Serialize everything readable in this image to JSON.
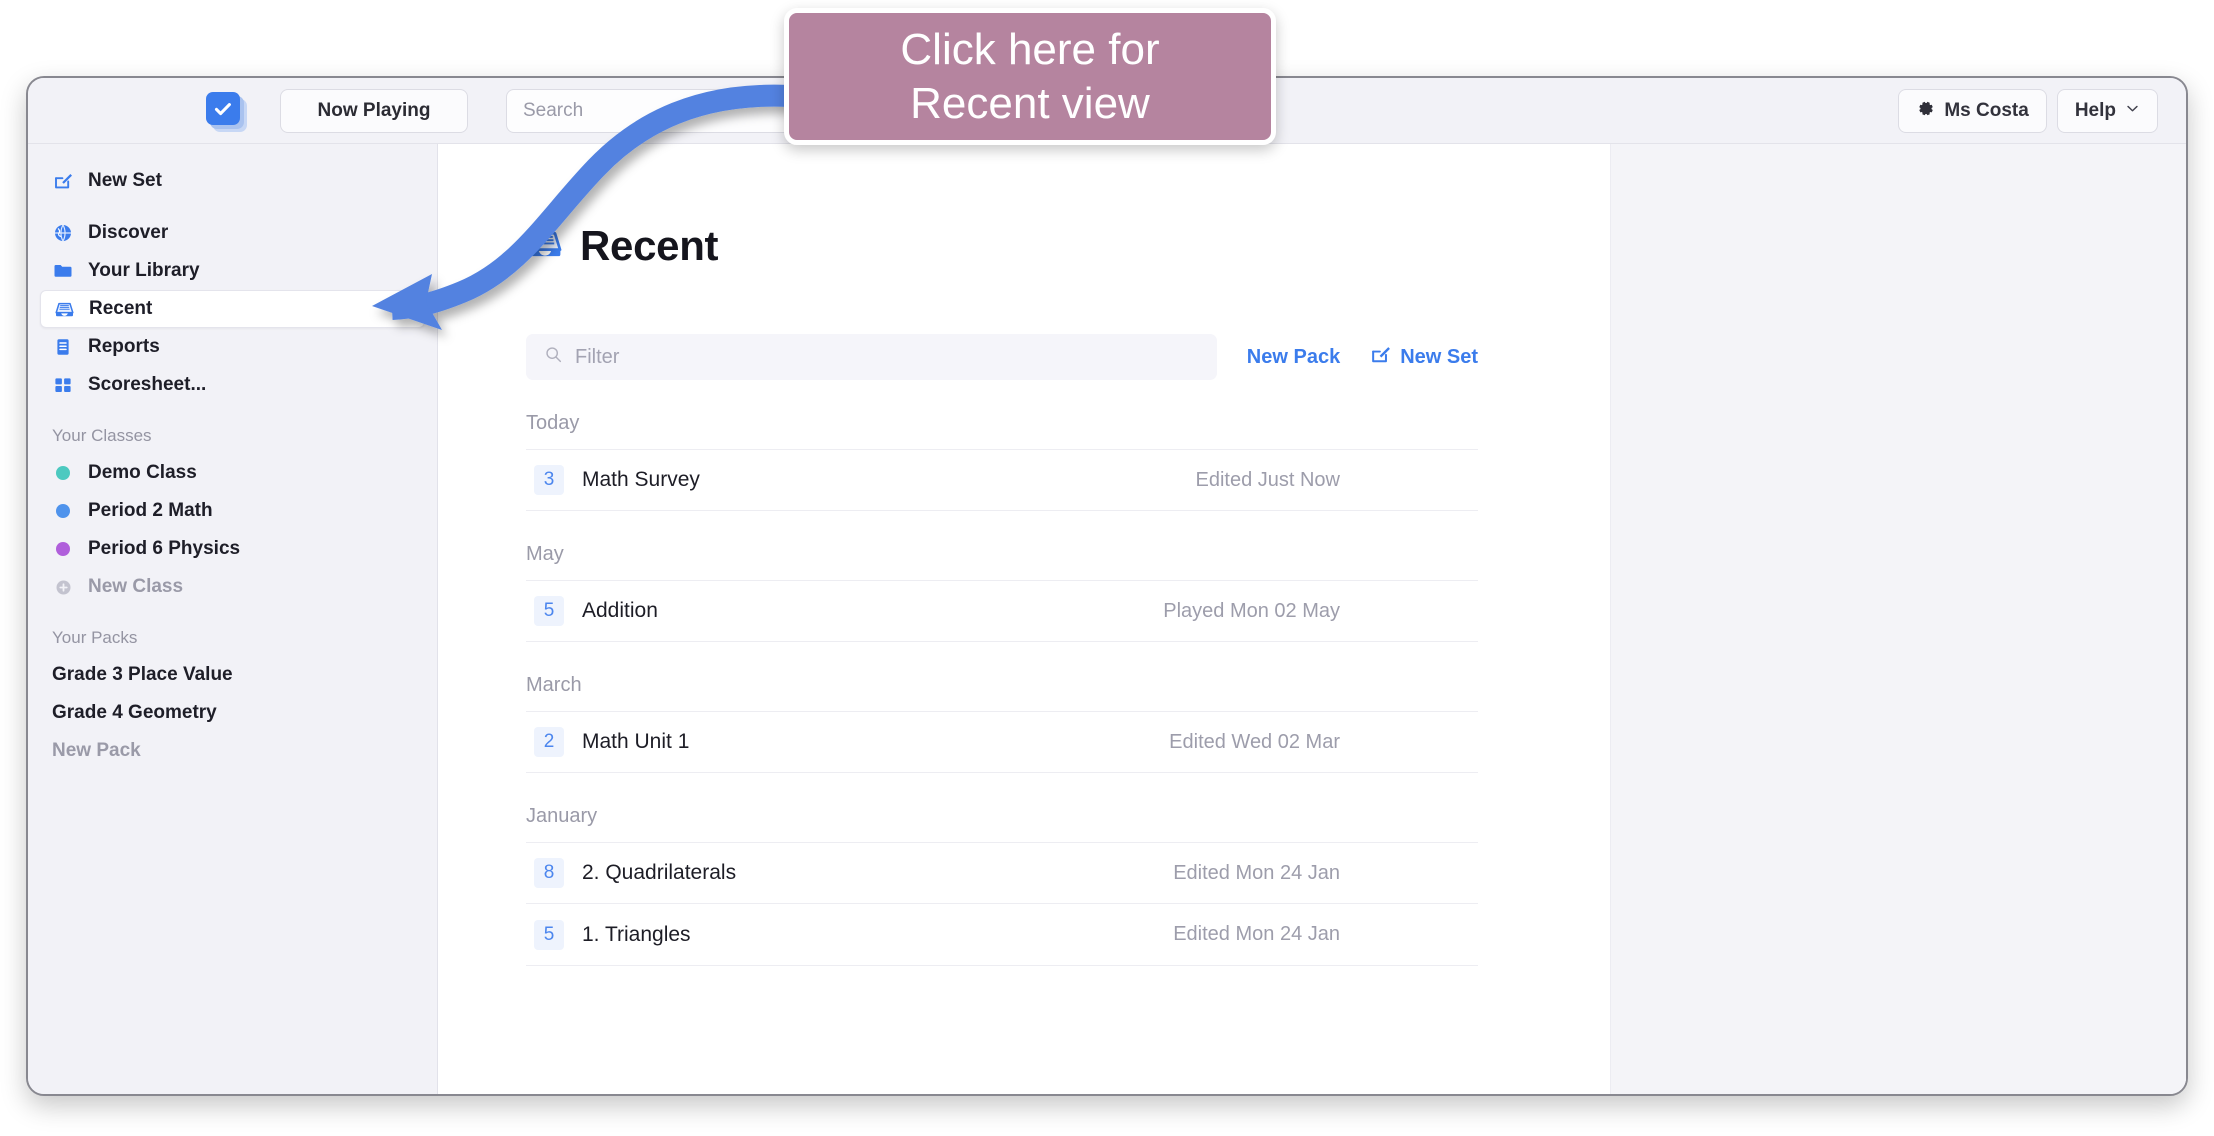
{
  "app": {
    "logo_icon": "checkbox-stack-icon",
    "now_playing_label": "Now Playing",
    "search_placeholder": "Search",
    "search_value": "",
    "account_label": "Ms Costa",
    "account_icon": "gear-icon",
    "help_label": "Help",
    "help_icon": "chevron-down-icon"
  },
  "callout": {
    "line1": "Click here for",
    "line2": "Recent view",
    "bg_color": "#b5849f",
    "text_color": "#ffffff"
  },
  "sidebar": {
    "primary": [
      {
        "label": "New Set",
        "icon": "pencil-square-icon",
        "selected": false
      },
      {
        "label": "Discover",
        "icon": "globe-icon",
        "selected": false
      },
      {
        "label": "Your Library",
        "icon": "folder-icon",
        "selected": false
      },
      {
        "label": "Recent",
        "icon": "inbox-tray-icon",
        "selected": true
      },
      {
        "label": "Reports",
        "icon": "document-list-icon",
        "selected": false
      },
      {
        "label": "Scoresheet...",
        "icon": "grid-icon",
        "selected": false
      }
    ],
    "classes_heading": "Your Classes",
    "classes": [
      {
        "label": "Demo Class",
        "color": "#4cc9c0"
      },
      {
        "label": "Period 2 Math",
        "color": "#4f93ec"
      },
      {
        "label": "Period 6 Physics",
        "color": "#b05fdb"
      }
    ],
    "new_class_label": "New Class",
    "new_class_icon": "plus-circle-icon",
    "packs_heading": "Your Packs",
    "packs": [
      {
        "label": "Grade 3 Place Value"
      },
      {
        "label": "Grade 4 Geometry"
      }
    ],
    "new_pack_label": "New Pack"
  },
  "main": {
    "title": "Recent",
    "title_icon": "inbox-tray-icon",
    "filter_placeholder": "Filter",
    "filter_value": "",
    "filter_icon": "search-icon",
    "new_pack_label": "New Pack",
    "new_set_label": "New Set",
    "new_set_icon": "pencil-square-icon",
    "groups": [
      {
        "label": "Today",
        "rows": [
          {
            "count": "3",
            "name": "Math Survey",
            "meta": "Edited Just Now"
          }
        ]
      },
      {
        "label": "May",
        "rows": [
          {
            "count": "5",
            "name": "Addition",
            "meta": "Played Mon 02 May"
          }
        ]
      },
      {
        "label": "March",
        "rows": [
          {
            "count": "2",
            "name": "Math Unit 1",
            "meta": "Edited Wed 02 Mar"
          }
        ]
      },
      {
        "label": "January",
        "rows": [
          {
            "count": "8",
            "name": "2. Quadrilaterals",
            "meta": "Edited Mon 24 Jan"
          },
          {
            "count": "5",
            "name": "1. Triangles",
            "meta": "Edited Mon 24 Jan"
          }
        ]
      }
    ]
  },
  "colors": {
    "accent_blue": "#3b7cec",
    "badge_bg": "#eef3fd",
    "sidebar_bg": "#f2f2f7",
    "callout_mauve": "#b5849f"
  }
}
